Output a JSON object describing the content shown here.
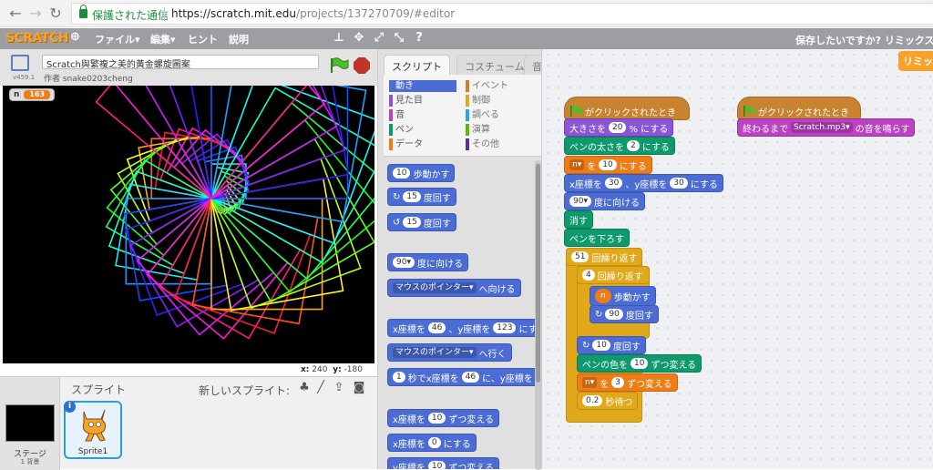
{
  "browser": {
    "secure_label": "保護された通信",
    "url_host": "https://scratch.mit.edu",
    "url_path": "/projects/137270709/#editor"
  },
  "menubar": {
    "logo": "SCRATCH",
    "file": "ファイル▾",
    "edit": "編集▾",
    "tips": "ヒント",
    "about": "説明",
    "save_message": "保存したいですか? リミックスをク"
  },
  "stage": {
    "title": "Scratch與繁複之美的黃金螺旋圖案",
    "author": "作者 snake0203cheng",
    "version": "v459.1",
    "variable_name": "n",
    "variable_value": "163",
    "x_label": "x:",
    "x_value": "240",
    "y_label": "y:",
    "y_value": "-180"
  },
  "sprites": {
    "title": "スプライト",
    "new_sprite": "新しいスプライト:",
    "stage_label": "ステージ",
    "backdrops": "1 背景",
    "sprite1": "Sprite1"
  },
  "palette": {
    "tab_scripts": "スクリプト",
    "tab_costumes": "コスチューム",
    "tab_sounds": "音",
    "categories": [
      {
        "label": "動き",
        "color": "#4a6cd4"
      },
      {
        "label": "見た目",
        "color": "#8a55d7"
      },
      {
        "label": "音",
        "color": "#bb42c3"
      },
      {
        "label": "ペン",
        "color": "#0e9a6c"
      },
      {
        "label": "データ",
        "color": "#ee7d16"
      },
      {
        "label": "イベント",
        "color": "#c88330"
      },
      {
        "label": "制御",
        "color": "#e1a91a"
      },
      {
        "label": "調べる",
        "color": "#2ca5e2"
      },
      {
        "label": "演算",
        "color": "#5cb712"
      },
      {
        "label": "その他",
        "color": "#632d99"
      }
    ],
    "blocks": {
      "move_n": "10",
      "move_lbl": "歩動かす",
      "turn_r_n": "15",
      "turn_lbl": "度回す",
      "turn_l_n": "15",
      "point_dir_n": "90▾",
      "point_dir_lbl": "度に向ける",
      "point_towards_dd": "マウスのポインター▾",
      "point_towards_lbl": "へ向ける",
      "goto_x_lbl": "x座標を",
      "goto_x": "46",
      "goto_y_lbl": "、y座標を",
      "goto_y": "123",
      "goto_end": "にす",
      "goto_dd": "マウスのポインター▾",
      "goto_lbl": "へ行く",
      "glide_n": "1",
      "glide_lbl": "秒でx座標を",
      "glide_x": "46",
      "glide_mid": "に、y座標を",
      "change_x_lbl": "x座標を",
      "change_x": "10",
      "change_x_end": "ずつ変える",
      "set_x_lbl": "x座標を",
      "set_x": "0",
      "set_x_end": "にする",
      "change_y_lbl": "y座標を",
      "change_y": "10",
      "change_y_end": "ずつ変える"
    }
  },
  "scripts": {
    "remix": "リミッ",
    "hat1": "がクリックされたとき",
    "size_lbl": "大きさを",
    "size_n": "20",
    "size_end": "% にする",
    "pensize_lbl": "ペンの太さを",
    "pensize_n": "2",
    "pensize_end": "にする",
    "setvar_dd": "n▾",
    "setvar_lbl": "を",
    "setvar_n": "10",
    "setvar_end": "にする",
    "goto_lbl": "x座標を",
    "goto_x": "30",
    "goto_mid": "、y座標を",
    "goto_y": "30",
    "goto_end": "にする",
    "dir_n": "90▾",
    "dir_lbl": "度に向ける",
    "clear": "消す",
    "pendown": "ペンを下ろす",
    "repeat1_n": "51",
    "repeat_lbl": "回繰り返す",
    "repeat2_n": "4",
    "move_var": "n",
    "move_lbl": "歩動かす",
    "turn1_n": "90",
    "turn_lbl": "度回す",
    "turn2_n": "10",
    "pencolor_lbl": "ペンの色を",
    "pencolor_n": "10",
    "pencolor_end": "ずつ変える",
    "chvar_dd": "n▾",
    "chvar_lbl": "を",
    "chvar_n": "3",
    "chvar_end": "ずつ変える",
    "wait_n": "0.2",
    "wait_lbl": "秒待つ",
    "hat2": "がクリックされたとき",
    "sound_lbl": "終わるまで",
    "sound_dd": "Scratch.mp3▾",
    "sound_end": "の音を鳴らす"
  }
}
